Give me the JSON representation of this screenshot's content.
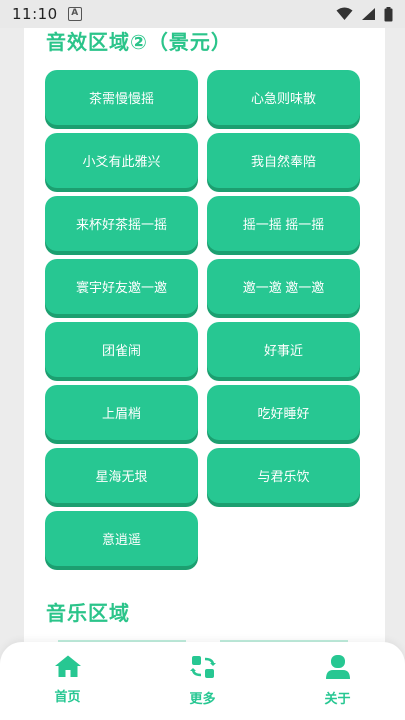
{
  "status_bar": {
    "time": "11:10",
    "notification_glyph": "A"
  },
  "sections": {
    "sound_effects": {
      "title": "音效区域②（景元）",
      "buttons": [
        "茶需慢慢摇",
        "心急则味散",
        "小爻有此雅兴",
        "我自然奉陪",
        "来杯好茶摇一摇",
        "摇一摇 摇一摇",
        "寰宇好友邀一邀",
        "邀一邀 邀一邀",
        "团雀闹",
        "好事近",
        "上眉梢",
        "吃好睡好",
        "星海无垠",
        "与君乐饮",
        "意逍遥"
      ]
    },
    "music": {
      "title": "音乐区域"
    }
  },
  "nav": {
    "home": "首页",
    "more": "更多",
    "about": "关于"
  },
  "colors": {
    "accent": "#27c792",
    "accent_shadow": "#1c9f70",
    "title": "#2bc48a"
  }
}
